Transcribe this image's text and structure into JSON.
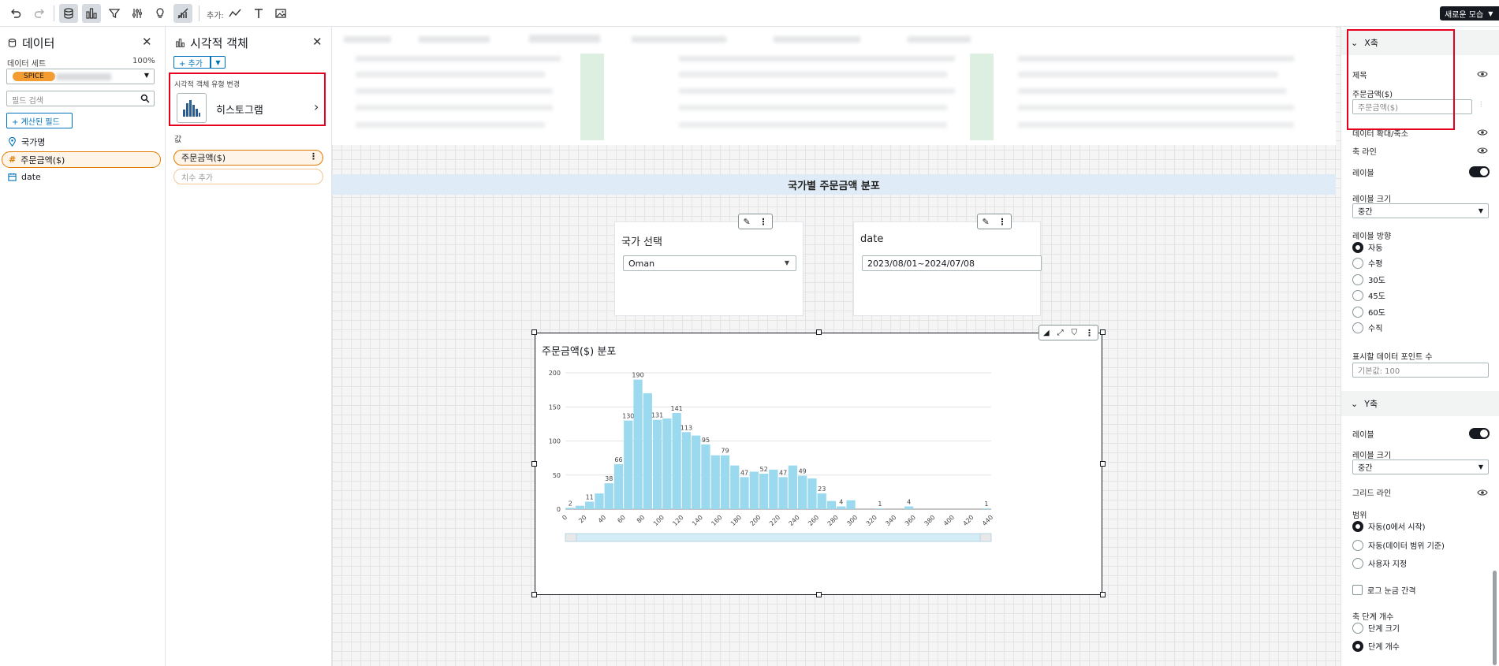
{
  "toolbar": {
    "add_label": "추가:",
    "new_button": "새로운 모습"
  },
  "data_panel": {
    "title": "데이터",
    "dataset_label": "데이터 세트",
    "dataset_percent": "100%",
    "spice_badge": "SPICE",
    "search_placeholder": "필드 검색",
    "calc_field_button": "+ 계산된 필드",
    "fields": [
      {
        "name": "국가명",
        "icon": "location-pin-icon"
      },
      {
        "name": "주문금액($)",
        "icon": "hash-icon",
        "selected": true
      },
      {
        "name": "date",
        "icon": "calendar-icon"
      }
    ]
  },
  "visual_panel": {
    "title": "시각적 객체",
    "add_button": "+ 추가",
    "change_type_label": "시각적 객체 유형 변경",
    "visual_type": "히스토그램",
    "value_label": "값",
    "value_field": "주문금액($)",
    "add_dimension": "치수 추가"
  },
  "canvas": {
    "section_title": "국가별 주문금액 분포",
    "country_control": {
      "title": "국가 선택",
      "value": "Oman"
    },
    "date_control": {
      "title": "date",
      "value": "2023/08/01~2024/07/08"
    },
    "chart_title": "주문금액($) 분포"
  },
  "chart_data": {
    "type": "bar",
    "title": "주문금액($) 분포",
    "bin_width": 10,
    "x_start": 0,
    "xlim": [
      0,
      440
    ],
    "ylim": [
      0,
      200
    ],
    "x_ticks": [
      0,
      20,
      40,
      60,
      80,
      100,
      120,
      140,
      160,
      180,
      200,
      220,
      240,
      260,
      280,
      300,
      320,
      340,
      360,
      380,
      400,
      420,
      440
    ],
    "y_ticks": [
      0,
      50,
      100,
      150,
      200
    ],
    "values": [
      2,
      5,
      11,
      23,
      38,
      66,
      130,
      190,
      170,
      131,
      133,
      141,
      113,
      108,
      95,
      79,
      79,
      64,
      47,
      55,
      52,
      58,
      47,
      64,
      49,
      45,
      23,
      12,
      4,
      13,
      0,
      0,
      1,
      0,
      0,
      4,
      0,
      0,
      0,
      0,
      0,
      0,
      0,
      1
    ],
    "labels": {
      "0": "2",
      "2": "11",
      "4": "38",
      "5": "66",
      "6": "130",
      "7": "190",
      "9": "131",
      "11": "141",
      "12": "113",
      "14": "95",
      "16": "79",
      "18": "47",
      "20": "52",
      "22": "47",
      "24": "49",
      "26": "23",
      "28": "4",
      "32": "1",
      "35": "4",
      "43": "1"
    },
    "bar_color": "#9bd9ef",
    "grid": true
  },
  "format_panel": {
    "x_axis": {
      "header": "X축",
      "title_label": "제목",
      "title_value": "주문금액($)",
      "title_placeholder": "주문금액($)",
      "data_zoom": "데이터 확대/축소",
      "axis_line": "축 라인",
      "label": "레이블",
      "label_size": "레이블 크기",
      "label_size_value": "중간",
      "label_direction": "레이블 방향",
      "directions": [
        {
          "label": "자동",
          "checked": true
        },
        {
          "label": "수평",
          "checked": false
        },
        {
          "label": "30도",
          "checked": false
        },
        {
          "label": "45도",
          "checked": false
        },
        {
          "label": "60도",
          "checked": false
        },
        {
          "label": "수직",
          "checked": false
        }
      ],
      "data_points_label": "표시할 데이터 포인트 수",
      "data_points_placeholder": "기본값: 100"
    },
    "y_axis": {
      "header": "Y축",
      "label": "레이블",
      "label_size": "레이블 크기",
      "label_size_value": "중간",
      "grid_line": "그리드 라인",
      "range_label": "범위",
      "ranges": [
        {
          "label": "자동(0에서 시작)",
          "checked": true
        },
        {
          "label": "자동(데이터 범위 기준)",
          "checked": false
        },
        {
          "label": "사용자 지정",
          "checked": false
        }
      ],
      "log_scale": "로그 눈금 간격",
      "axis_steps_label": "축 단계 개수",
      "steps": [
        {
          "label": "단계 크기",
          "checked": false
        },
        {
          "label": "단계 개수",
          "checked": true
        }
      ]
    }
  }
}
